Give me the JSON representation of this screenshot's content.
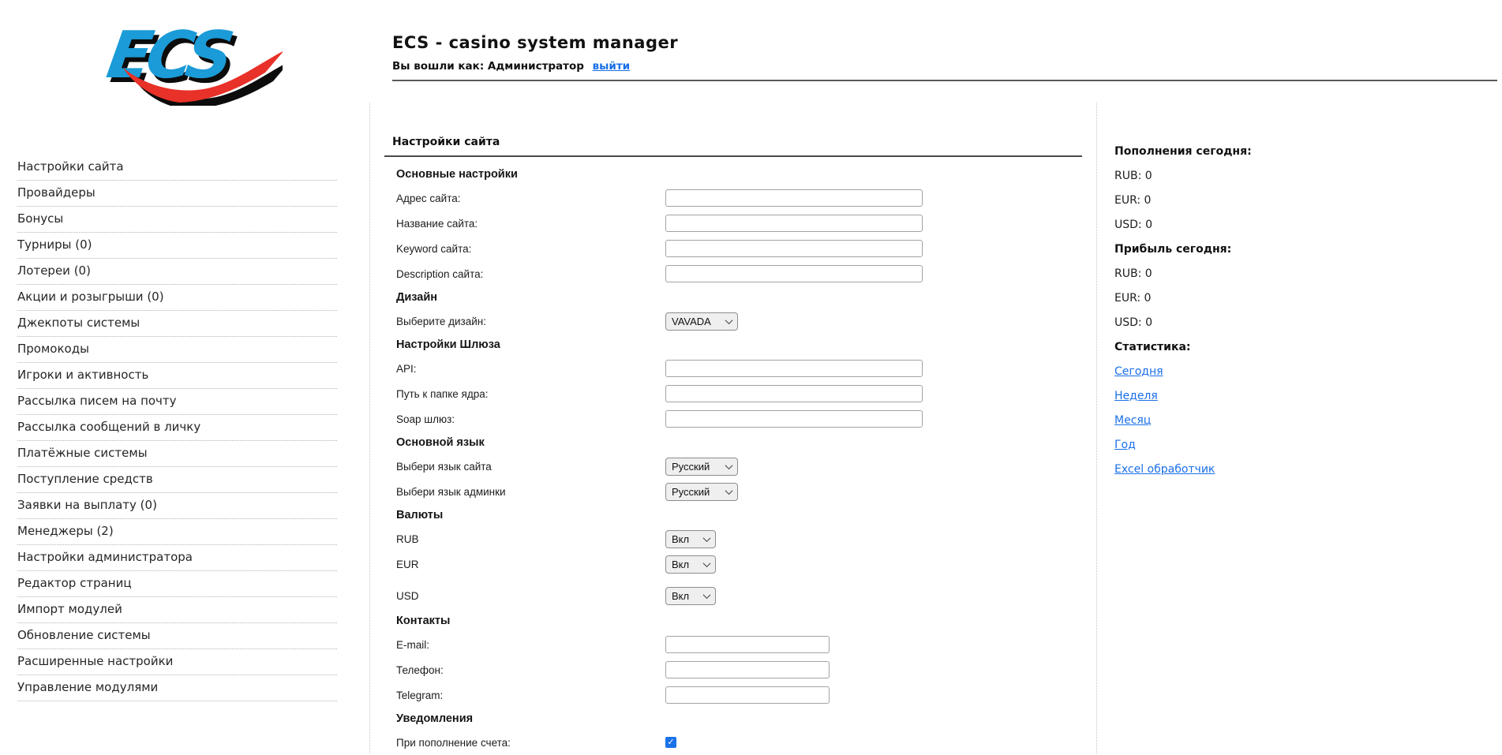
{
  "header": {
    "logo": "ECS",
    "title": "ECS - casino system manager",
    "login_text": "Вы вошли как: Администратор",
    "logout_link": "выйти"
  },
  "sidebar": {
    "items": [
      "Настройки сайта",
      "Провайдеры",
      "Бонусы",
      "Турниры (0)",
      "Лотереи (0)",
      "Акции и розыгрыши (0)",
      "Джекпоты системы",
      "Промокоды",
      "Игроки и активность",
      "Рассылка писем на почту",
      "Рассылка сообщений в личку",
      "Платёжные системы",
      "Поступление средств",
      "Заявки на выплату (0)",
      "Менеджеры (2)",
      "Настройки администратора",
      "Редактор страниц",
      "Импорт модулей",
      "Обновление системы",
      "Расширенные настройки",
      "Управление модулями"
    ]
  },
  "main": {
    "title": "Настройки сайта",
    "rows": [
      {
        "kind": "section",
        "name": "section-general",
        "label": "Основные настройки"
      },
      {
        "kind": "text",
        "name": "site-address",
        "label": "Адрес сайта:",
        "value": ""
      },
      {
        "kind": "text",
        "name": "site-title",
        "label": "Название сайта:",
        "value": ""
      },
      {
        "kind": "text",
        "name": "site-keyword",
        "label": "Keyword сайта:",
        "value": ""
      },
      {
        "kind": "text",
        "name": "site-description",
        "label": "Description сайта:",
        "value": ""
      },
      {
        "kind": "section",
        "name": "section-design",
        "label": "Дизайн"
      },
      {
        "kind": "select",
        "name": "design",
        "label": "Выберите дизайн:",
        "value": "VAVADA",
        "size": "wide"
      },
      {
        "kind": "section",
        "name": "section-gateway",
        "label": "Настройки Шлюза"
      },
      {
        "kind": "text",
        "name": "api",
        "label": "API:",
        "value": ""
      },
      {
        "kind": "text",
        "name": "core-folder-path",
        "label": "Путь к папке ядра:",
        "value": ""
      },
      {
        "kind": "text",
        "name": "soap-gateway",
        "label": "Soap шлюз:",
        "value": ""
      },
      {
        "kind": "section",
        "name": "section-language",
        "label": "Основной язык"
      },
      {
        "kind": "select",
        "name": "site-language",
        "label": "Выбери язык сайта",
        "value": "Русский",
        "size": "wide"
      },
      {
        "kind": "select",
        "name": "admin-language",
        "label": "Выбери язык админки",
        "value": "Русский",
        "size": "wide"
      },
      {
        "kind": "section",
        "name": "section-currencies",
        "label": "Валюты"
      },
      {
        "kind": "select",
        "name": "rub",
        "label": "RUB",
        "value": "Вкл",
        "size": "small"
      },
      {
        "kind": "select",
        "name": "eur",
        "label": "EUR",
        "value": "Вкл",
        "size": "small"
      },
      {
        "kind": "select",
        "name": "usd",
        "label": "USD",
        "value": "Вкл",
        "size": "small"
      },
      {
        "kind": "section",
        "name": "section-contacts",
        "label": "Контакты"
      },
      {
        "kind": "text",
        "name": "email",
        "label": "E-mail:",
        "value": "",
        "size": "short"
      },
      {
        "kind": "text",
        "name": "phone",
        "label": "Телефон:",
        "value": "",
        "size": "short"
      },
      {
        "kind": "text",
        "name": "telegram",
        "label": "Telegram:",
        "value": "",
        "size": "short"
      },
      {
        "kind": "section",
        "name": "section-notifications",
        "label": "Уведомления"
      },
      {
        "kind": "checkbox",
        "name": "notify-on-deposit",
        "label": "При пополнение счета:",
        "checked": true
      }
    ]
  },
  "stats": {
    "lines": [
      {
        "kind": "header",
        "name": "deposits-header",
        "text": "Пополнения сегодня:"
      },
      {
        "kind": "text",
        "name": "deposits-rub",
        "text": "RUB: 0"
      },
      {
        "kind": "text",
        "name": "deposits-eur",
        "text": "EUR: 0"
      },
      {
        "kind": "text",
        "name": "deposits-usd",
        "text": "USD: 0"
      },
      {
        "kind": "header",
        "name": "profit-header",
        "text": "Прибыль сегодня:"
      },
      {
        "kind": "text",
        "name": "profit-rub",
        "text": "RUB: 0"
      },
      {
        "kind": "text",
        "name": "profit-eur",
        "text": "EUR: 0"
      },
      {
        "kind": "text",
        "name": "profit-usd",
        "text": "USD: 0"
      },
      {
        "kind": "header",
        "name": "stats-header",
        "text": "Статистика:"
      },
      {
        "kind": "link",
        "name": "link-today",
        "text": "Сегодня"
      },
      {
        "kind": "link",
        "name": "link-week",
        "text": "Неделя"
      },
      {
        "kind": "link",
        "name": "link-month",
        "text": "Месяц"
      },
      {
        "kind": "link",
        "name": "link-year",
        "text": "Год"
      },
      {
        "kind": "link",
        "name": "link-excel-handler",
        "text": "Excel обработчик"
      }
    ]
  },
  "icons": {
    "check": "✓"
  },
  "colors": {
    "link_blue": "#1a6fe8",
    "logo_blue": "#1b9bd7",
    "logo_red": "#e83128",
    "checkbox_blue": "#1a73e8",
    "rule_dark": "#4a4a4a"
  }
}
